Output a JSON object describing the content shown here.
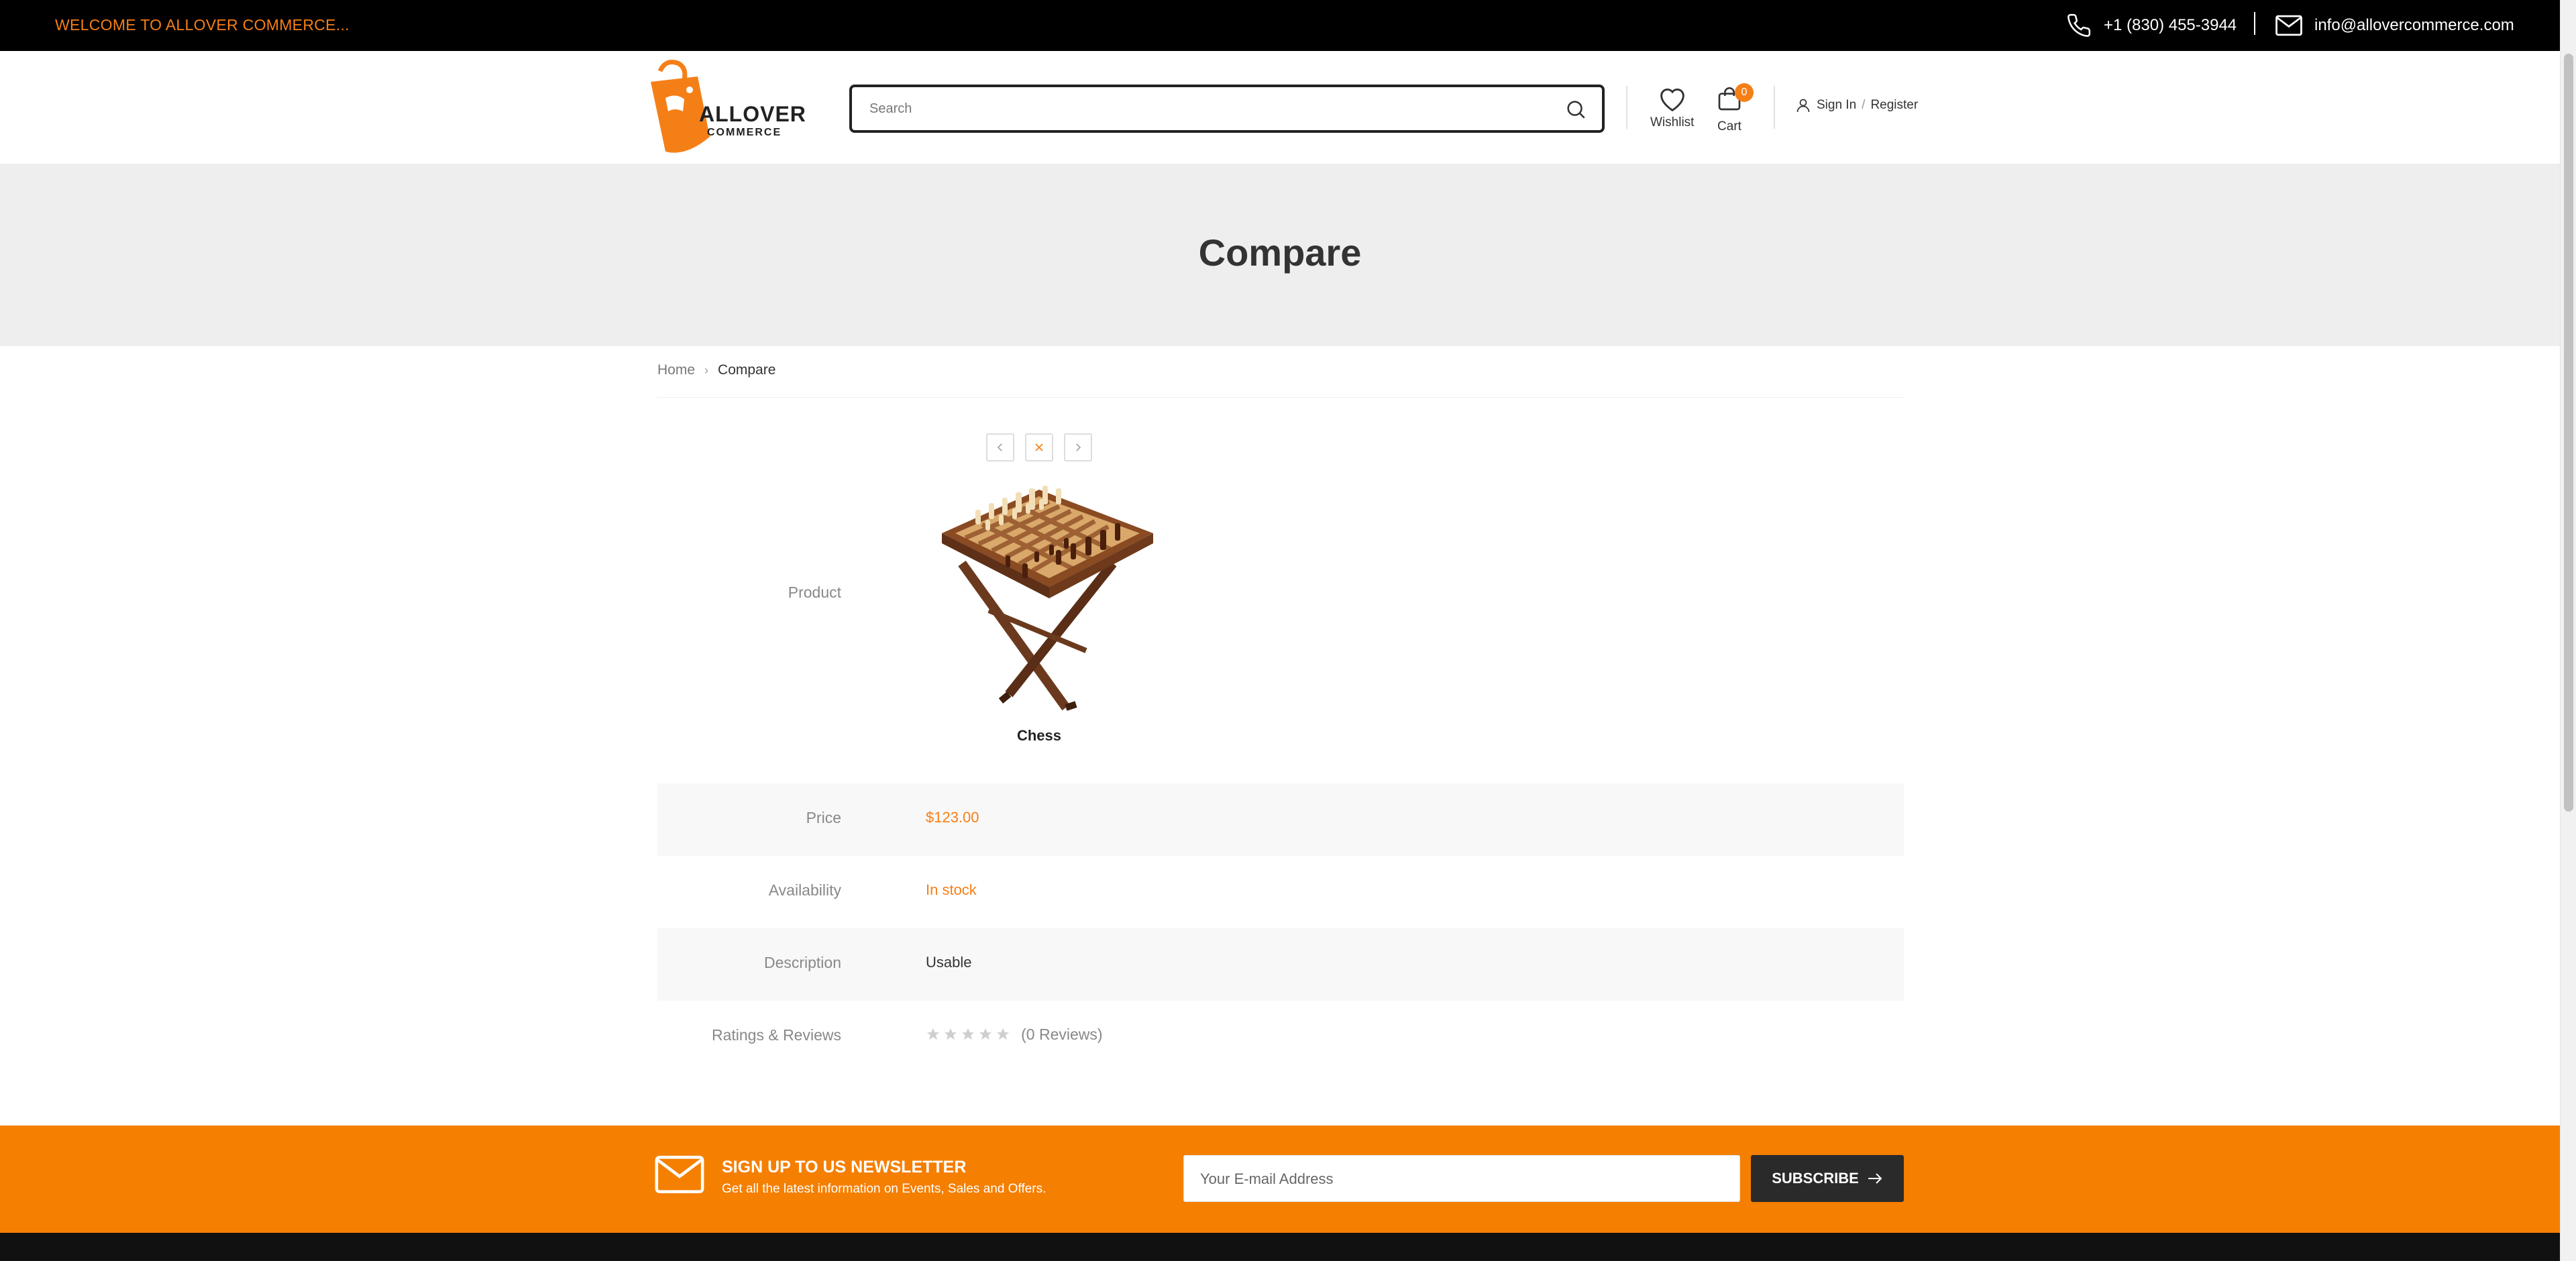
{
  "topbar": {
    "welcome": "WELCOME TO ALLOVER COMMERCE...",
    "phone": "+1 (830) 455-3944",
    "email": "info@allovercommerce.com"
  },
  "header": {
    "logo_line1": "ALLOVER",
    "logo_line2": "COMMERCE",
    "search_placeholder": "Search",
    "wishlist_label": "Wishlist",
    "cart_label": "Cart",
    "cart_count": "0",
    "signin_label": "Sign In",
    "register_label": "Register"
  },
  "banner": {
    "title": "Compare"
  },
  "breadcrumb": {
    "home": "Home",
    "current": "Compare"
  },
  "compare": {
    "product_label": "Product",
    "product_name": "Chess",
    "price_label": "Price",
    "price": "$123.00",
    "availability_label": "Availability",
    "availability": "In stock",
    "description_label": "Description",
    "description": "Usable",
    "ratings_label": "Ratings & Reviews",
    "rating": 0,
    "reviews": "(0 Reviews)"
  },
  "newsletter": {
    "title": "SIGN UP TO US NEWSLETTER",
    "subtitle": "Get all the latest information on Events, Sales and Offers.",
    "placeholder": "Your E-mail Address",
    "button_label": "SUBSCRIBE"
  },
  "colors": {
    "accent": "#f57f17",
    "topbar_bg": "#000000",
    "banner_bg": "#eeeeee",
    "newsletter_bg": "#f57f00",
    "button_bg": "#2a2a2a"
  }
}
